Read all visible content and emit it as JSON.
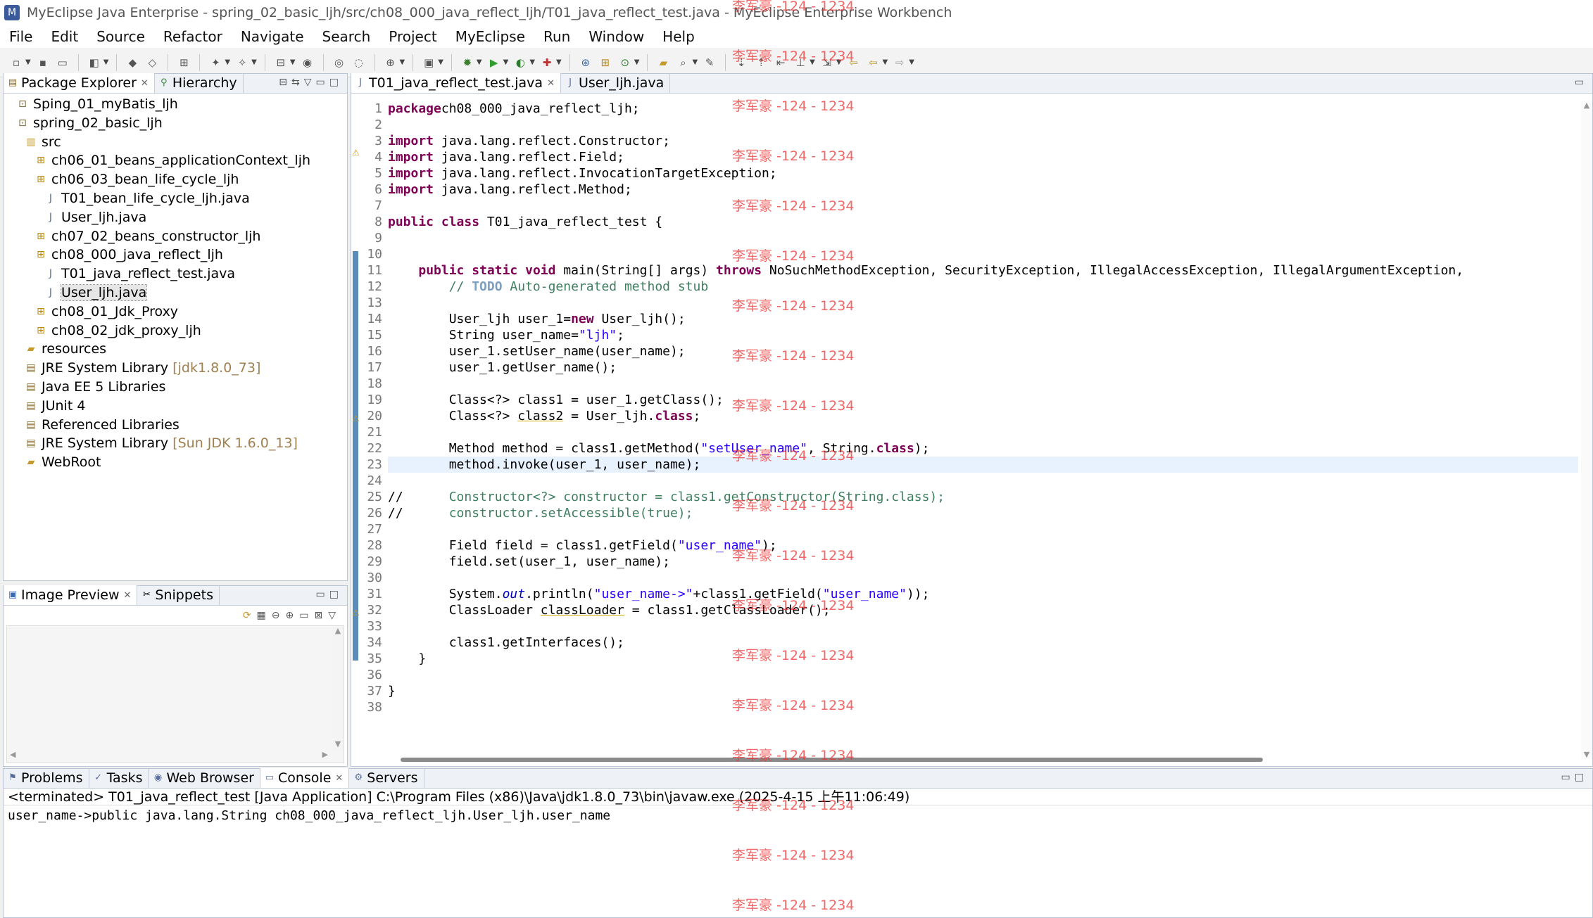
{
  "window": {
    "title": "MyEclipse Java Enterprise - spring_02_basic_ljh/src/ch08_000_java_reflect_ljh/T01_java_reflect_test.java - MyEclipse Enterprise Workbench"
  },
  "menu": [
    "File",
    "Edit",
    "Source",
    "Refactor",
    "Navigate",
    "Search",
    "Project",
    "MyEclipse",
    "Run",
    "Window",
    "Help"
  ],
  "explorer": {
    "tabs": [
      "Package Explorer",
      "Hierarchy"
    ],
    "tree": [
      {
        "label": "Sping_01_myBatis_ljh",
        "icon": "project-icon",
        "depth": 1
      },
      {
        "label": "spring_02_basic_ljh",
        "icon": "project-icon",
        "depth": 1
      },
      {
        "label": "src",
        "icon": "source-folder-icon",
        "depth": 2
      },
      {
        "label": "ch06_01_beans_applicationContext_ljh",
        "icon": "package-icon",
        "depth": 3
      },
      {
        "label": "ch06_03_bean_life_cycle_ljh",
        "icon": "package-icon",
        "depth": 3
      },
      {
        "label": "T01_bean_life_cycle_ljh.java",
        "icon": "java-file-icon",
        "depth": 4
      },
      {
        "label": "User_ljh.java",
        "icon": "java-file-icon",
        "depth": 4
      },
      {
        "label": "ch07_02_beans_constructor_ljh",
        "icon": "package-icon",
        "depth": 3
      },
      {
        "label": "ch08_000_java_reflect_ljh",
        "icon": "package-icon",
        "depth": 3
      },
      {
        "label": "T01_java_reflect_test.java",
        "icon": "java-file-icon",
        "depth": 4
      },
      {
        "label": "User_ljh.java",
        "icon": "java-file-icon",
        "depth": 4,
        "selected": true
      },
      {
        "label": "ch08_01_Jdk_Proxy",
        "icon": "package-icon",
        "depth": 3
      },
      {
        "label": "ch08_02_jdk_proxy_ljh",
        "icon": "package-icon",
        "depth": 3
      },
      {
        "label": "resources",
        "icon": "folder-icon",
        "depth": 2
      },
      {
        "label": "JRE System Library",
        "decoration": "[jdk1.8.0_73]",
        "icon": "library-icon",
        "depth": 2
      },
      {
        "label": "Java EE 5 Libraries",
        "icon": "library-icon",
        "depth": 2
      },
      {
        "label": "JUnit 4",
        "icon": "library-icon",
        "depth": 2
      },
      {
        "label": "Referenced Libraries",
        "icon": "library-icon",
        "depth": 2
      },
      {
        "label": "JRE System Library",
        "decoration": "[Sun JDK 1.6.0_13]",
        "icon": "library-icon",
        "depth": 2
      },
      {
        "label": "WebRoot",
        "icon": "folder-icon",
        "depth": 2
      }
    ]
  },
  "preview": {
    "tabs": [
      "Image Preview",
      "Snippets"
    ]
  },
  "editor": {
    "tabs": [
      "T01_java_reflect_test.java",
      "User_ljh.java"
    ],
    "current_line": 23,
    "lines": [
      [
        [
          "kw",
          "package"
        ],
        [
          "",
          "ch08_000_java_reflect_ljh;"
        ]
      ],
      [],
      [
        [
          "kw",
          "import"
        ],
        [
          "",
          " java.lang.reflect.Constructor;"
        ]
      ],
      [
        [
          "kw",
          "import"
        ],
        [
          "",
          " java.lang.reflect.Field;"
        ]
      ],
      [
        [
          "kw",
          "import"
        ],
        [
          "",
          " java.lang.reflect.InvocationTargetException;"
        ]
      ],
      [
        [
          "kw",
          "import"
        ],
        [
          "",
          " java.lang.reflect.Method;"
        ]
      ],
      [],
      [
        [
          "kw",
          "public"
        ],
        [
          "",
          " "
        ],
        [
          "kw",
          "class"
        ],
        [
          "",
          " T01_java_reflect_test {"
        ]
      ],
      [],
      [],
      [
        [
          "",
          "    "
        ],
        [
          "kw",
          "public"
        ],
        [
          "",
          " "
        ],
        [
          "kw",
          "static"
        ],
        [
          "",
          " "
        ],
        [
          "kw",
          "void"
        ],
        [
          "",
          " main(String[] args) "
        ],
        [
          "kw",
          "throws"
        ],
        [
          "",
          " NoSuchMethodException, SecurityException, IllegalAccessException, IllegalArgumentException,"
        ]
      ],
      [
        [
          "",
          "        "
        ],
        [
          "cm",
          "// "
        ],
        [
          "todo",
          "TODO"
        ],
        [
          "cm",
          " Auto-generated method stub"
        ]
      ],
      [],
      [
        [
          "",
          "        User_ljh user_1="
        ],
        [
          "kw",
          "new"
        ],
        [
          "",
          " User_ljh();"
        ]
      ],
      [
        [
          "",
          "        String user_name="
        ],
        [
          "str",
          "\"ljh\""
        ],
        [
          "",
          ";"
        ]
      ],
      [
        [
          "",
          "        user_1.setUser_name(user_name);"
        ]
      ],
      [
        [
          "",
          "        user_1.getUser_name();"
        ]
      ],
      [],
      [
        [
          "",
          "        Class<?> class1 = user_1.getClass();"
        ]
      ],
      [
        [
          "",
          "        Class<?> "
        ],
        [
          "ul",
          "class2"
        ],
        [
          "",
          " = User_ljh."
        ],
        [
          "kw",
          "class"
        ],
        [
          "",
          ";"
        ]
      ],
      [],
      [
        [
          "",
          "        Method method = class1.getMethod("
        ],
        [
          "str",
          "\"setUser_name\""
        ],
        [
          "",
          ", String."
        ],
        [
          "kw",
          "class"
        ],
        [
          "",
          ");"
        ]
      ],
      [
        [
          "",
          "        method.invoke(user_1, user_name);"
        ]
      ],
      [],
      [
        [
          "",
          "//      "
        ],
        [
          "cm",
          "Constructor<?> constructor = class1.getConstructor(String.class);"
        ]
      ],
      [
        [
          "",
          "//      "
        ],
        [
          "cm",
          "constructor.setAccessible(true);"
        ]
      ],
      [],
      [
        [
          "",
          "        Field field = class1.getField("
        ],
        [
          "str",
          "\"user_name\""
        ],
        [
          "",
          ");"
        ]
      ],
      [
        [
          "",
          "        field.set(user_1, user_name);"
        ]
      ],
      [],
      [
        [
          "",
          "        System."
        ],
        [
          "fld",
          "out"
        ],
        [
          "",
          ".println("
        ],
        [
          "str",
          "\"user_name->\""
        ],
        [
          "",
          "+class1.getField("
        ],
        [
          "str",
          "\"user_name\""
        ],
        [
          "",
          "));"
        ]
      ],
      [
        [
          "",
          "        ClassLoader "
        ],
        [
          "ul",
          "classLoader"
        ],
        [
          "",
          " = class1.getClassLoader();"
        ]
      ],
      [],
      [
        [
          "",
          "        class1.getInterfaces();"
        ]
      ],
      [
        [
          "",
          "    }"
        ]
      ],
      [],
      [
        [
          "",
          "}"
        ]
      ],
      []
    ]
  },
  "bottom": {
    "tabs": [
      "Problems",
      "Tasks",
      "Web Browser",
      "Console",
      "Servers"
    ],
    "console_header": "<terminated> T01_java_reflect_test [Java Application] C:\\Program Files (x86)\\Java\\jdk1.8.0_73\\bin\\javaw.exe (2025-4-15 上午11:06:49)",
    "console_output": "user_name->public java.lang.String ch08_000_java_reflect_ljh.User_ljh.user_name"
  },
  "watermark": "李军豪 -124 - 1234"
}
